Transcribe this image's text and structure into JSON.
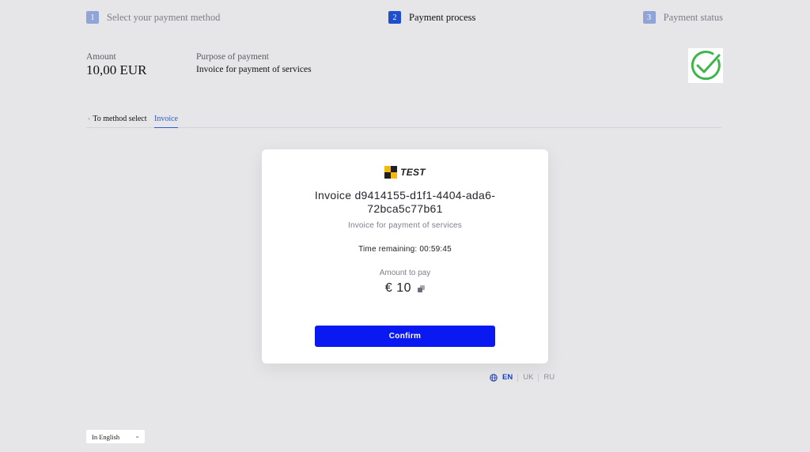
{
  "stepper": {
    "steps": [
      {
        "number": "1",
        "label": "Select your payment method",
        "state": "inactive"
      },
      {
        "number": "2",
        "label": "Payment process",
        "state": "active"
      },
      {
        "number": "3",
        "label": "Payment status",
        "state": "inactive"
      }
    ]
  },
  "summary": {
    "amount_label": "Amount",
    "amount_value": "10,00 EUR",
    "purpose_label": "Purpose of payment",
    "purpose_value": "Invoice for payment of services"
  },
  "status": {
    "icon": "check-circle-icon",
    "color": "#3cb54a"
  },
  "tabs": {
    "back_label": "To method select",
    "invoice_label": "Invoice"
  },
  "card": {
    "brand_name": "TEST",
    "invoice_title": "Invoice d9414155-d1f1-4404-ada6-72bca5c77b61",
    "invoice_description": "Invoice for payment of services",
    "time_remaining": "Time remaining: 00:59:45",
    "amount_label": "Amount to pay",
    "amount_value": "€ 10",
    "confirm_label": "Confirm"
  },
  "languages": {
    "items": [
      "EN",
      "UK",
      "RU"
    ],
    "active": "EN"
  },
  "footer": {
    "language_select_value": "In English"
  },
  "colors": {
    "accent": "#0a19f2",
    "active_step": "#1f4fcf",
    "inactive_step": "#90a4d8",
    "success": "#3cb54a"
  }
}
